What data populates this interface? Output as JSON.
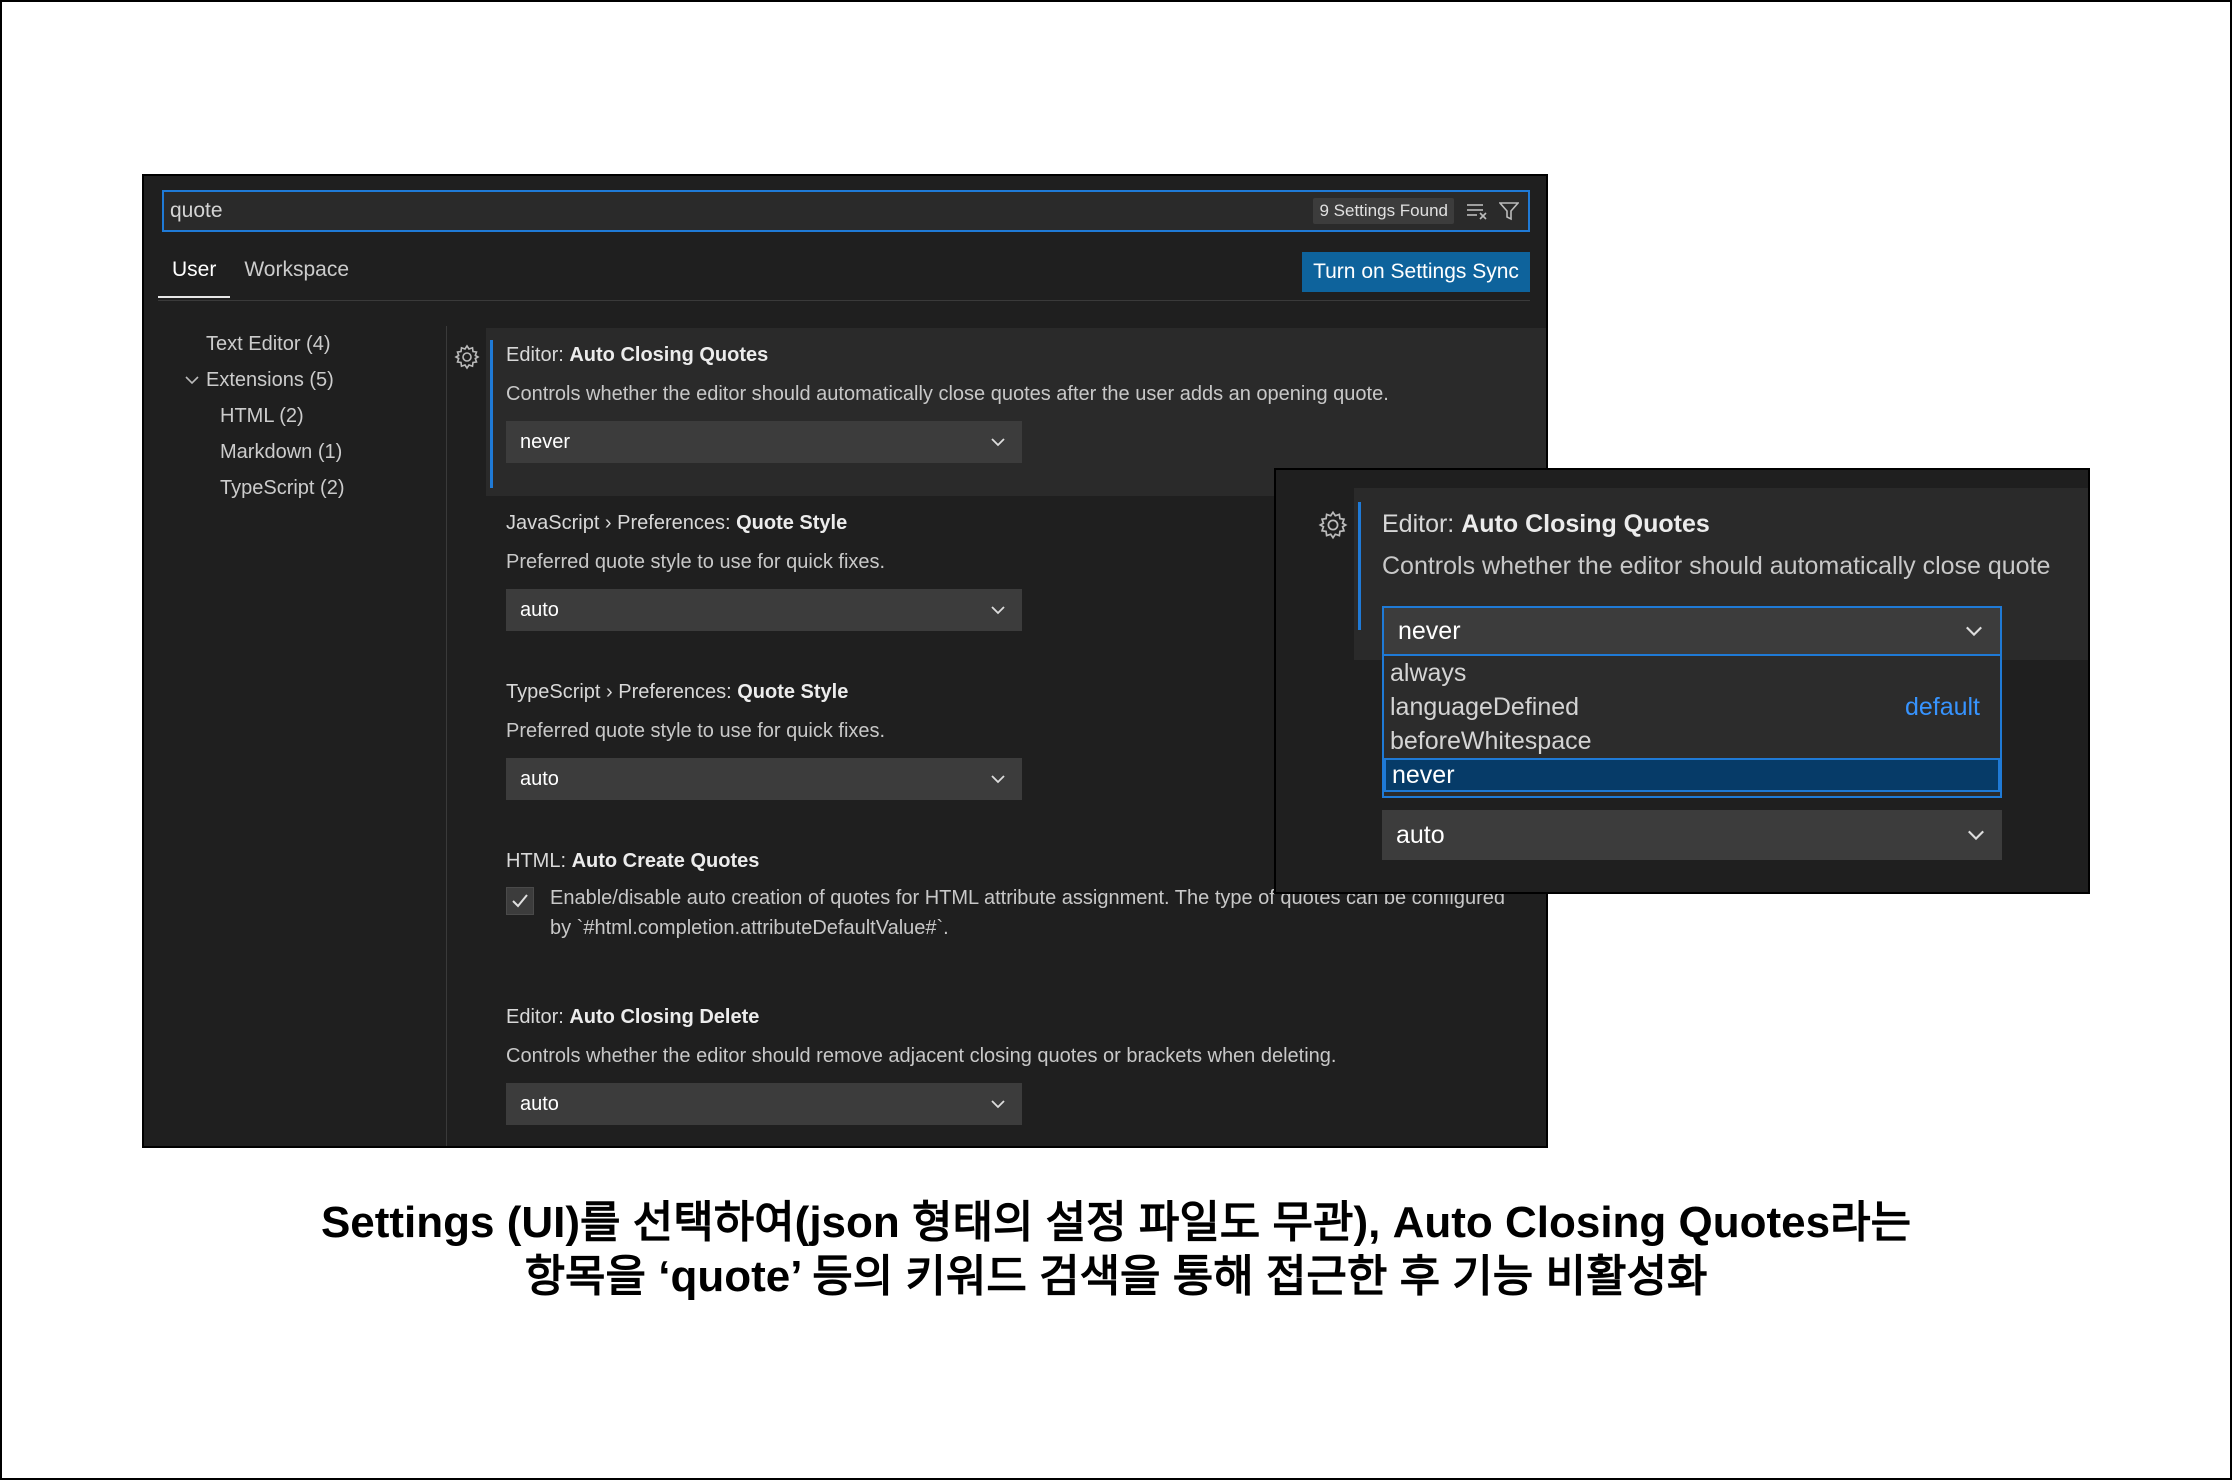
{
  "search": {
    "query": "quote",
    "results_badge": "9 Settings Found"
  },
  "tabs": [
    {
      "label": "User"
    },
    {
      "label": "Workspace"
    }
  ],
  "sync_button": "Turn on Settings Sync",
  "tree": [
    {
      "label": "Text Editor (4)"
    },
    {
      "label": "Extensions (5)"
    },
    {
      "label": "HTML (2)"
    },
    {
      "label": "Markdown (1)"
    },
    {
      "label": "TypeScript (2)"
    }
  ],
  "settings": [
    {
      "prefix": "Editor: ",
      "name": "Auto Closing Quotes",
      "description": "Controls whether the editor should automatically close quotes after the user adds an opening quote.",
      "value": "never"
    },
    {
      "prefix": "JavaScript › Preferences: ",
      "name": "Quote Style",
      "description": "Preferred quote style to use for quick fixes.",
      "value": "auto"
    },
    {
      "prefix": "TypeScript › Preferences: ",
      "name": "Quote Style",
      "description": "Preferred quote style to use for quick fixes.",
      "value": "auto"
    },
    {
      "prefix": "HTML: ",
      "name": "Auto Create Quotes",
      "description": "Enable/disable auto creation of quotes for HTML attribute assignment. The type of quotes can be configured by `#html.completion.attributeDefaultValue#`.",
      "checked": true
    },
    {
      "prefix": "Editor: ",
      "name": "Auto Closing Delete",
      "description": "Controls whether the editor should remove adjacent closing quotes or brackets when deleting.",
      "value": "auto"
    }
  ],
  "inset": {
    "prefix": "Editor: ",
    "name": "Auto Closing Quotes",
    "description": "Controls whether the editor should automatically close quote",
    "selected": "never",
    "options": [
      {
        "label": "always",
        "badge": ""
      },
      {
        "label": "languageDefined",
        "badge": "default"
      },
      {
        "label": "beforeWhitespace",
        "badge": ""
      },
      {
        "label": "never",
        "badge": ""
      }
    ],
    "next_value": "auto"
  },
  "caption": {
    "line1": "Settings (UI)를 선택하여(json 형태의 설정 파일도 무관), Auto Closing Quotes라는",
    "line2": "항목을 ‘quote’ 등의 키워드 검색을 통해 접근한 후 기능 비활성화"
  },
  "colors": {
    "accent": "#1f7ad6",
    "button": "#0e639c",
    "background": "#1f1f1f",
    "default_badge": "#3794ff"
  }
}
